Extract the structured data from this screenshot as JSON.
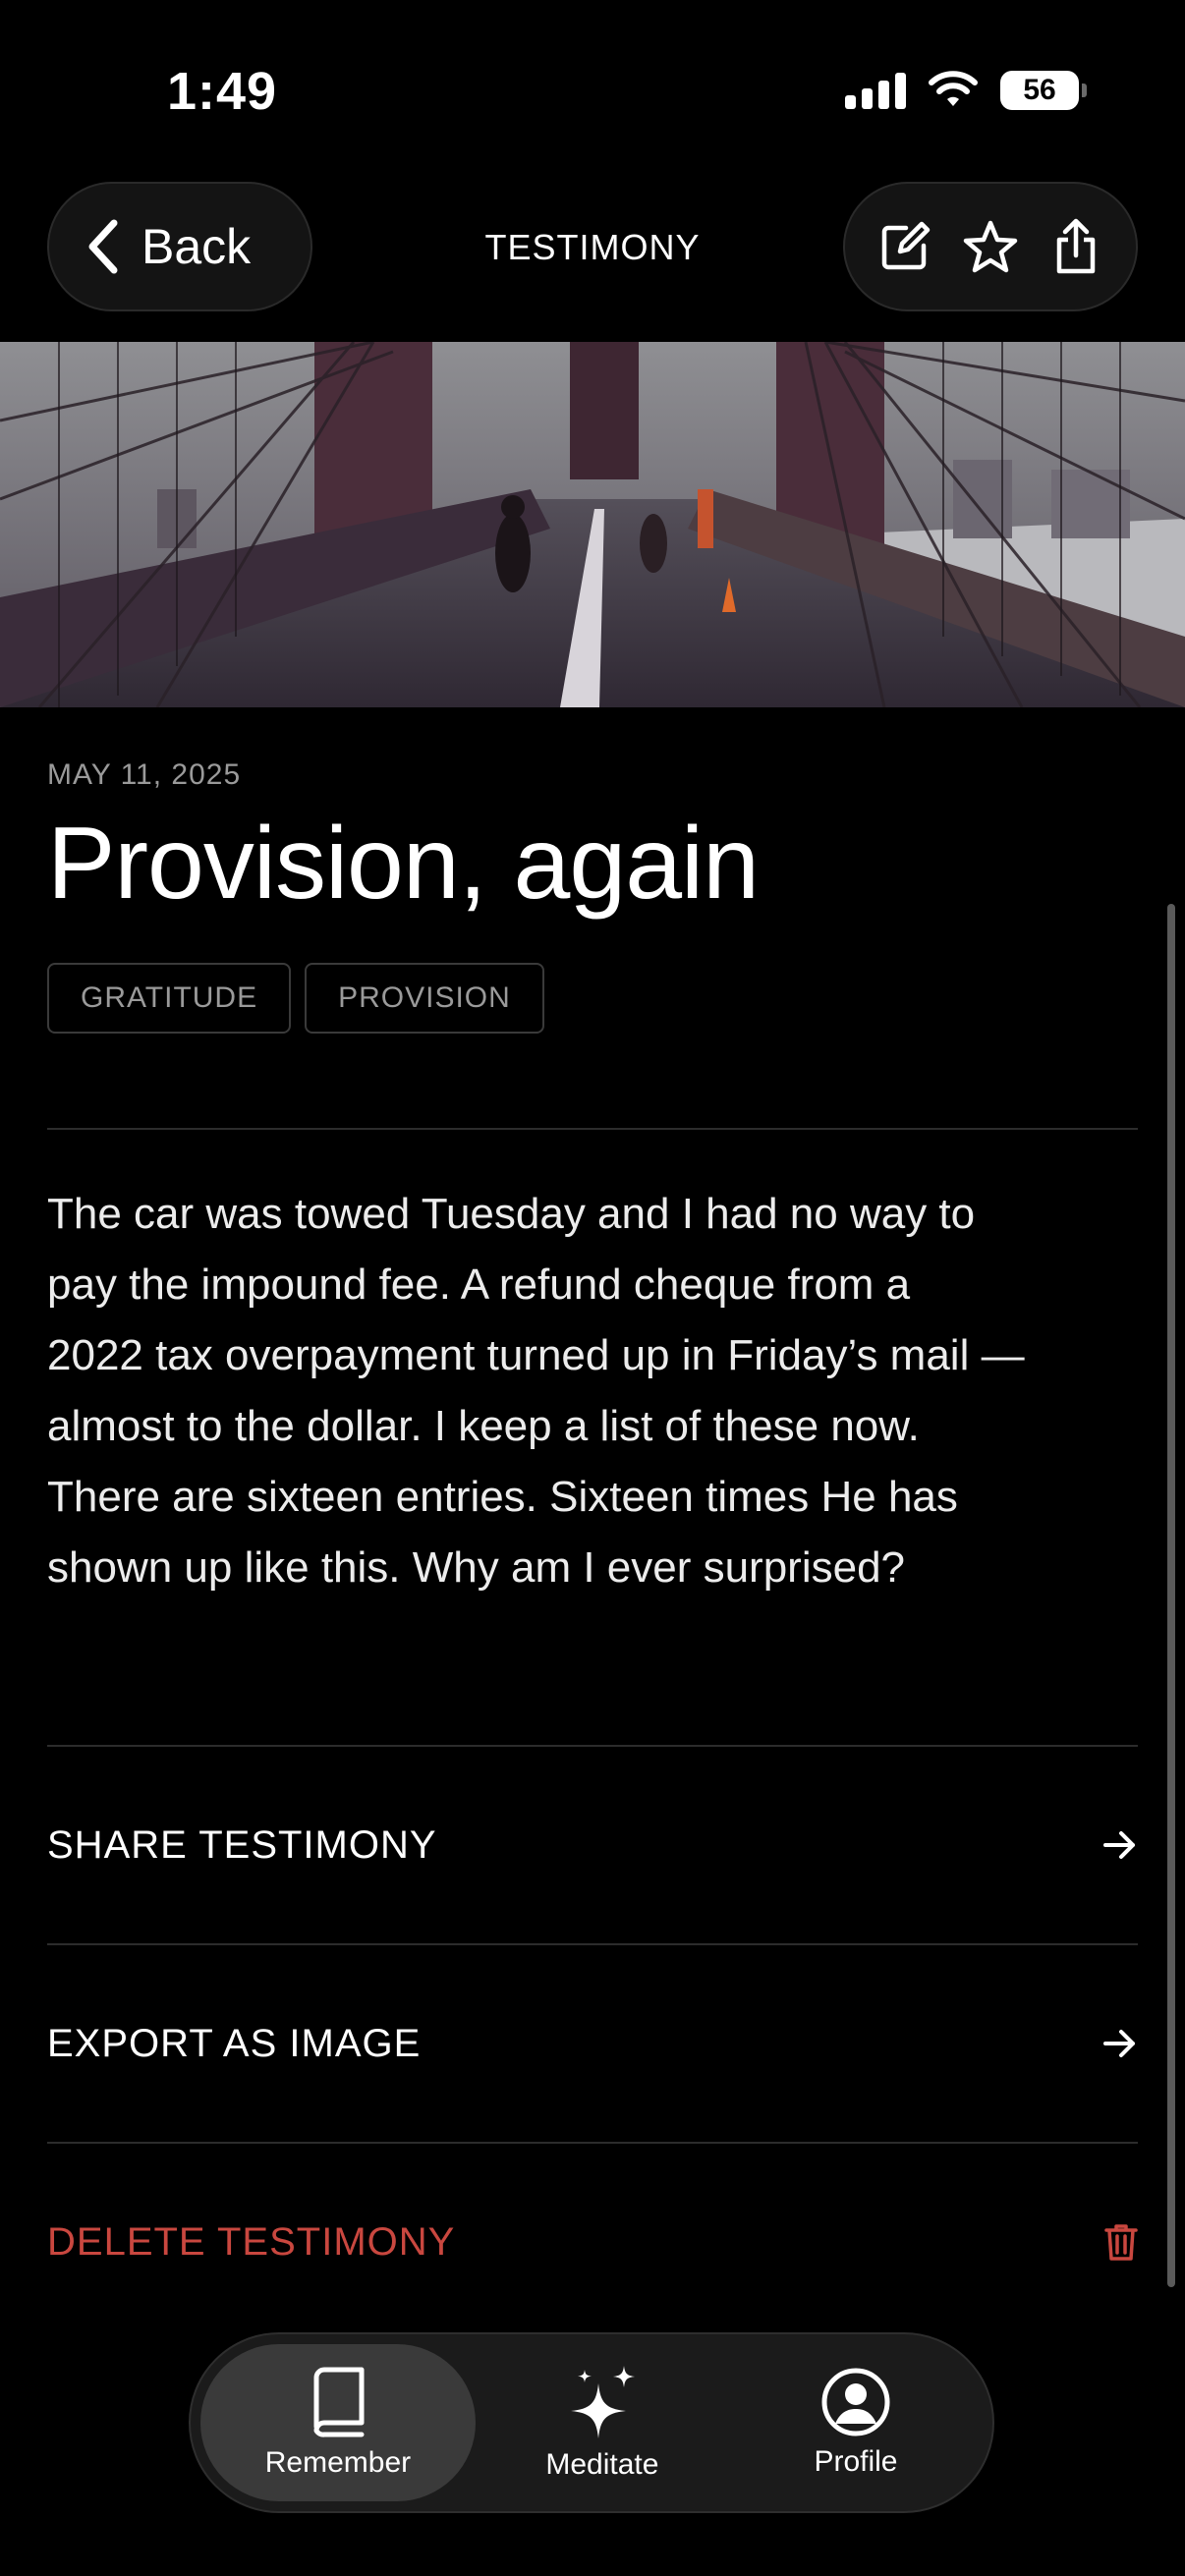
{
  "status_bar": {
    "time": "1:49",
    "battery": "56"
  },
  "header": {
    "back_label": "Back",
    "title": "TESTIMONY",
    "icons": [
      "edit-icon",
      "star-icon",
      "share-icon"
    ]
  },
  "entry": {
    "date": "MAY 11, 2025",
    "title": "Provision, again",
    "tags": [
      "GRATITUDE",
      "PROVISION"
    ],
    "body_lines": [
      "The car was towed Tuesday and I had no way to",
      "pay the impound fee. A refund cheque from a",
      "2022 tax overpayment turned up in Friday’s mail —",
      "almost to the dollar. I keep a list of these now.",
      "There are sixteen entries. Sixteen times He has",
      "shown up like this. Why am I ever surprised?"
    ]
  },
  "actions": {
    "share_label": "SHARE TESTIMONY",
    "export_label": "EXPORT AS IMAGE",
    "delete_label": "DELETE TESTIMONY"
  },
  "tab_bar": {
    "tabs": [
      {
        "label": "Remember",
        "icon": "book-icon",
        "active": true
      },
      {
        "label": "Meditate",
        "icon": "sparkle-icon",
        "active": false
      },
      {
        "label": "Profile",
        "icon": "profile-icon",
        "active": false
      }
    ]
  },
  "colors": {
    "background": "#000000",
    "danger": "#c9473f",
    "tag_border": "#3a3a3a",
    "tab_active": "#3a3a3a"
  }
}
